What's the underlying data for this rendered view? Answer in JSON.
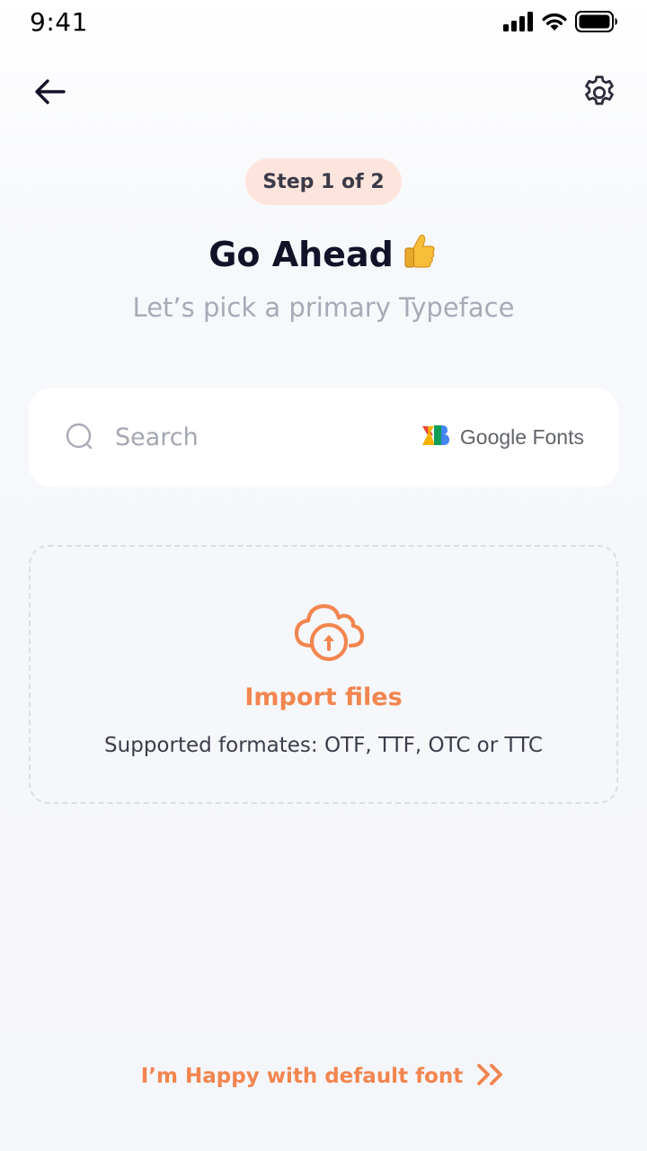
{
  "status_bar": {
    "time": "9:41",
    "icons": [
      "cellular-signal-icon",
      "wifi-icon",
      "battery-icon"
    ]
  },
  "nav": {
    "back_icon": "arrow-left-icon",
    "settings_icon": "gear-icon"
  },
  "step_badge": "Step 1 of 2",
  "title": "Go Ahead",
  "title_emoji": "👍",
  "subtitle": "Let’s pick a primary Typeface",
  "search": {
    "placeholder": "Search",
    "value": "",
    "provider_label": "Google Fonts",
    "provider_icon": "google-fonts-icon"
  },
  "import": {
    "icon": "cloud-upload-icon",
    "title": "Import files",
    "subtitle": "Supported formates: OTF, TTF, OTC or TTC"
  },
  "footer_link": {
    "label": "I’m Happy with default font",
    "icon": "double-chevron-right-icon"
  },
  "colors": {
    "accent": "#F3854F",
    "badge_bg": "#FDE5DD",
    "title": "#121229",
    "muted": "#A7AAB7",
    "card_bg": "#FFFFFF",
    "page_bg": "#F6F7FA"
  }
}
